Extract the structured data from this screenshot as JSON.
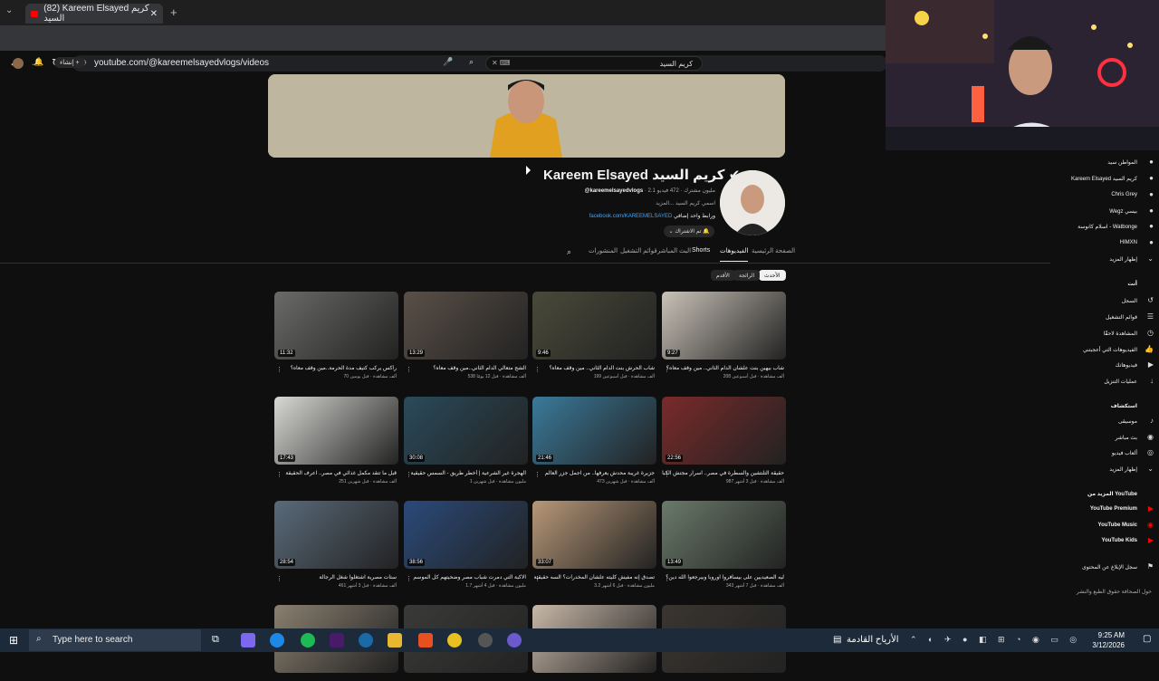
{
  "browser": {
    "tab_title": "(82) Kareem Elsayed كريم السيد",
    "url": "youtube.com/@kareemelsayedvlogs/videos"
  },
  "yt_header": {
    "search_value": "كريم السيد",
    "create_label": "إنشاء"
  },
  "channel": {
    "name": "Kareem Elsayed كريم السيد",
    "handle": "@kareemelsayedvlogs",
    "stats": "2.1 مليون مشترك · 472 فيديو",
    "description": "اسمي كريم السيد ...المزيد",
    "link": "facebook.com/KAREEMELSAYED",
    "link_more": "ورابط واحد إضافي",
    "subscribed_label": "تم الاشتراك"
  },
  "channel_tabs": [
    "الصفحة الرئيسية",
    "الفيديوهات",
    "Shorts",
    "البث المباشر",
    "قوائم التشغيل",
    "المنشورات"
  ],
  "sort_chips": [
    "الأحدث",
    "الرائجة",
    "الأقدم"
  ],
  "videos": [
    {
      "title": "شاب بيهين بنت علشان الدام الثاني.. مين وقف معاه؟",
      "meta": "208 ألف مشاهدة · قبل أسبوعين",
      "duration": "9:27",
      "color": "#c9c2b8"
    },
    {
      "title": "شاب الحرش بنت الدام الثاني.. مين وقف معاه؟",
      "meta": "199 ألف مشاهدة · قبل أسبوعين",
      "duration": "9:46",
      "color": "#4a4a3a"
    },
    {
      "title": "الشج متعالي الدام الثاني..مين وقف معاه؟",
      "meta": "538 ألف مشاهدة · قبل 12 يومًا",
      "duration": "13:29",
      "color": "#5a5048"
    },
    {
      "title": "راكس يركب كتيف مدة الحرمة..مين وقف معاه؟",
      "meta": "70 ألف مشاهدة · قبل يومين",
      "duration": "11:32",
      "color": "#6a6a68"
    },
    {
      "title": "حقيقة التلتشين والسطرة في مصر.. اسرار مجتش الكبا",
      "meta": "987 ألف مشاهدة · قبل 3 أشهر",
      "duration": "22:56",
      "color": "#7a2a2a"
    },
    {
      "title": "جزيرة غريبة محدش يعرفها.. من اجمل جزر العالم",
      "meta": "473 ألف مشاهدة · قبل شهرين",
      "duration": "21:46",
      "color": "#3a7a9a"
    },
    {
      "title": "الهجرة غير الشرعية | أخطر طريق - السمس حقيقية",
      "meta": "1 مليون مشاهدة · قبل شهرين",
      "duration": "30:08",
      "color": "#2a4a5a"
    },
    {
      "title": "قبل ما تتقد مكمل غذائي في مصر.. اعرف الحقيقة",
      "meta": "251 ألف مشاهدة · قبل شهرين",
      "duration": "17:43",
      "color": "#d8d8d4"
    },
    {
      "title": "ليه الصعيديين على بيسافروا اوروبا وبيرجعوا الله دين؟",
      "meta": "343 ألف مشاهدة · قبل 7 أشهر",
      "duration": "13:49",
      "color": "#6a7a6a"
    },
    {
      "title": "تصدق إنه مفيش كليته علشان المخدرات؟ السه حقيقية",
      "meta": "3.2 مليون مشاهدة · قبل 6 أشهر",
      "duration": "33:07",
      "color": "#b89878"
    },
    {
      "title": "الاكبة التي دمرت شباب مصر وضحيتهم كل الموسم",
      "meta": "1.7 مليون مشاهدة · قبل 4 أشهر",
      "duration": "38:56",
      "color": "#2a4a7a"
    },
    {
      "title": "ستات مصرية اشتغلوا شغل الرجالة",
      "meta": "461 ألف مشاهدة · قبل 3 أشهر",
      "duration": "28:54",
      "color": "#5a6a7a"
    },
    {
      "title": "",
      "meta": "",
      "duration": "",
      "color": "#3a3530"
    },
    {
      "title": "",
      "meta": "",
      "duration": "",
      "color": "#c8b8a8"
    },
    {
      "title": "",
      "meta": "",
      "duration": "",
      "color": "#3a3a38"
    },
    {
      "title": "",
      "meta": "",
      "duration": "",
      "color": "#8a8070"
    }
  ],
  "sidebar": {
    "subscriptions": [
      "المواطن سيد",
      "Kareem Elsayed كريم السيد",
      "Chris Grey",
      "Wegz بيسي",
      "اسلام كانوسة - Watbonge",
      "HIMXN",
      "إظهار المزيد"
    ],
    "you_title": "أنت",
    "you_items": [
      "السجل",
      "قوائم التشغيل",
      "المشاهدة لاحقًا",
      "الفيديوهات التي أعجبتني",
      "فيديوهاتك",
      "عمليات التنزيل"
    ],
    "explore_title": "استكشاف",
    "explore_items": [
      "موسيقى",
      "بث مباشر",
      "ألعاب فيديو",
      "إظهار المزيد"
    ],
    "more_title": "المزيد من YouTube",
    "more_items": [
      "YouTube Premium",
      "YouTube Music",
      "YouTube Kids"
    ],
    "report": "سجل الإبلاغ عن المحتوى",
    "footer": "حول  الصحافة  حقوق الطبع والنشر"
  },
  "taskbar": {
    "search_placeholder": "Type here to search",
    "weather": "الأرياح القادمة",
    "time": "9:25 AM",
    "date": "3/12/2026"
  }
}
